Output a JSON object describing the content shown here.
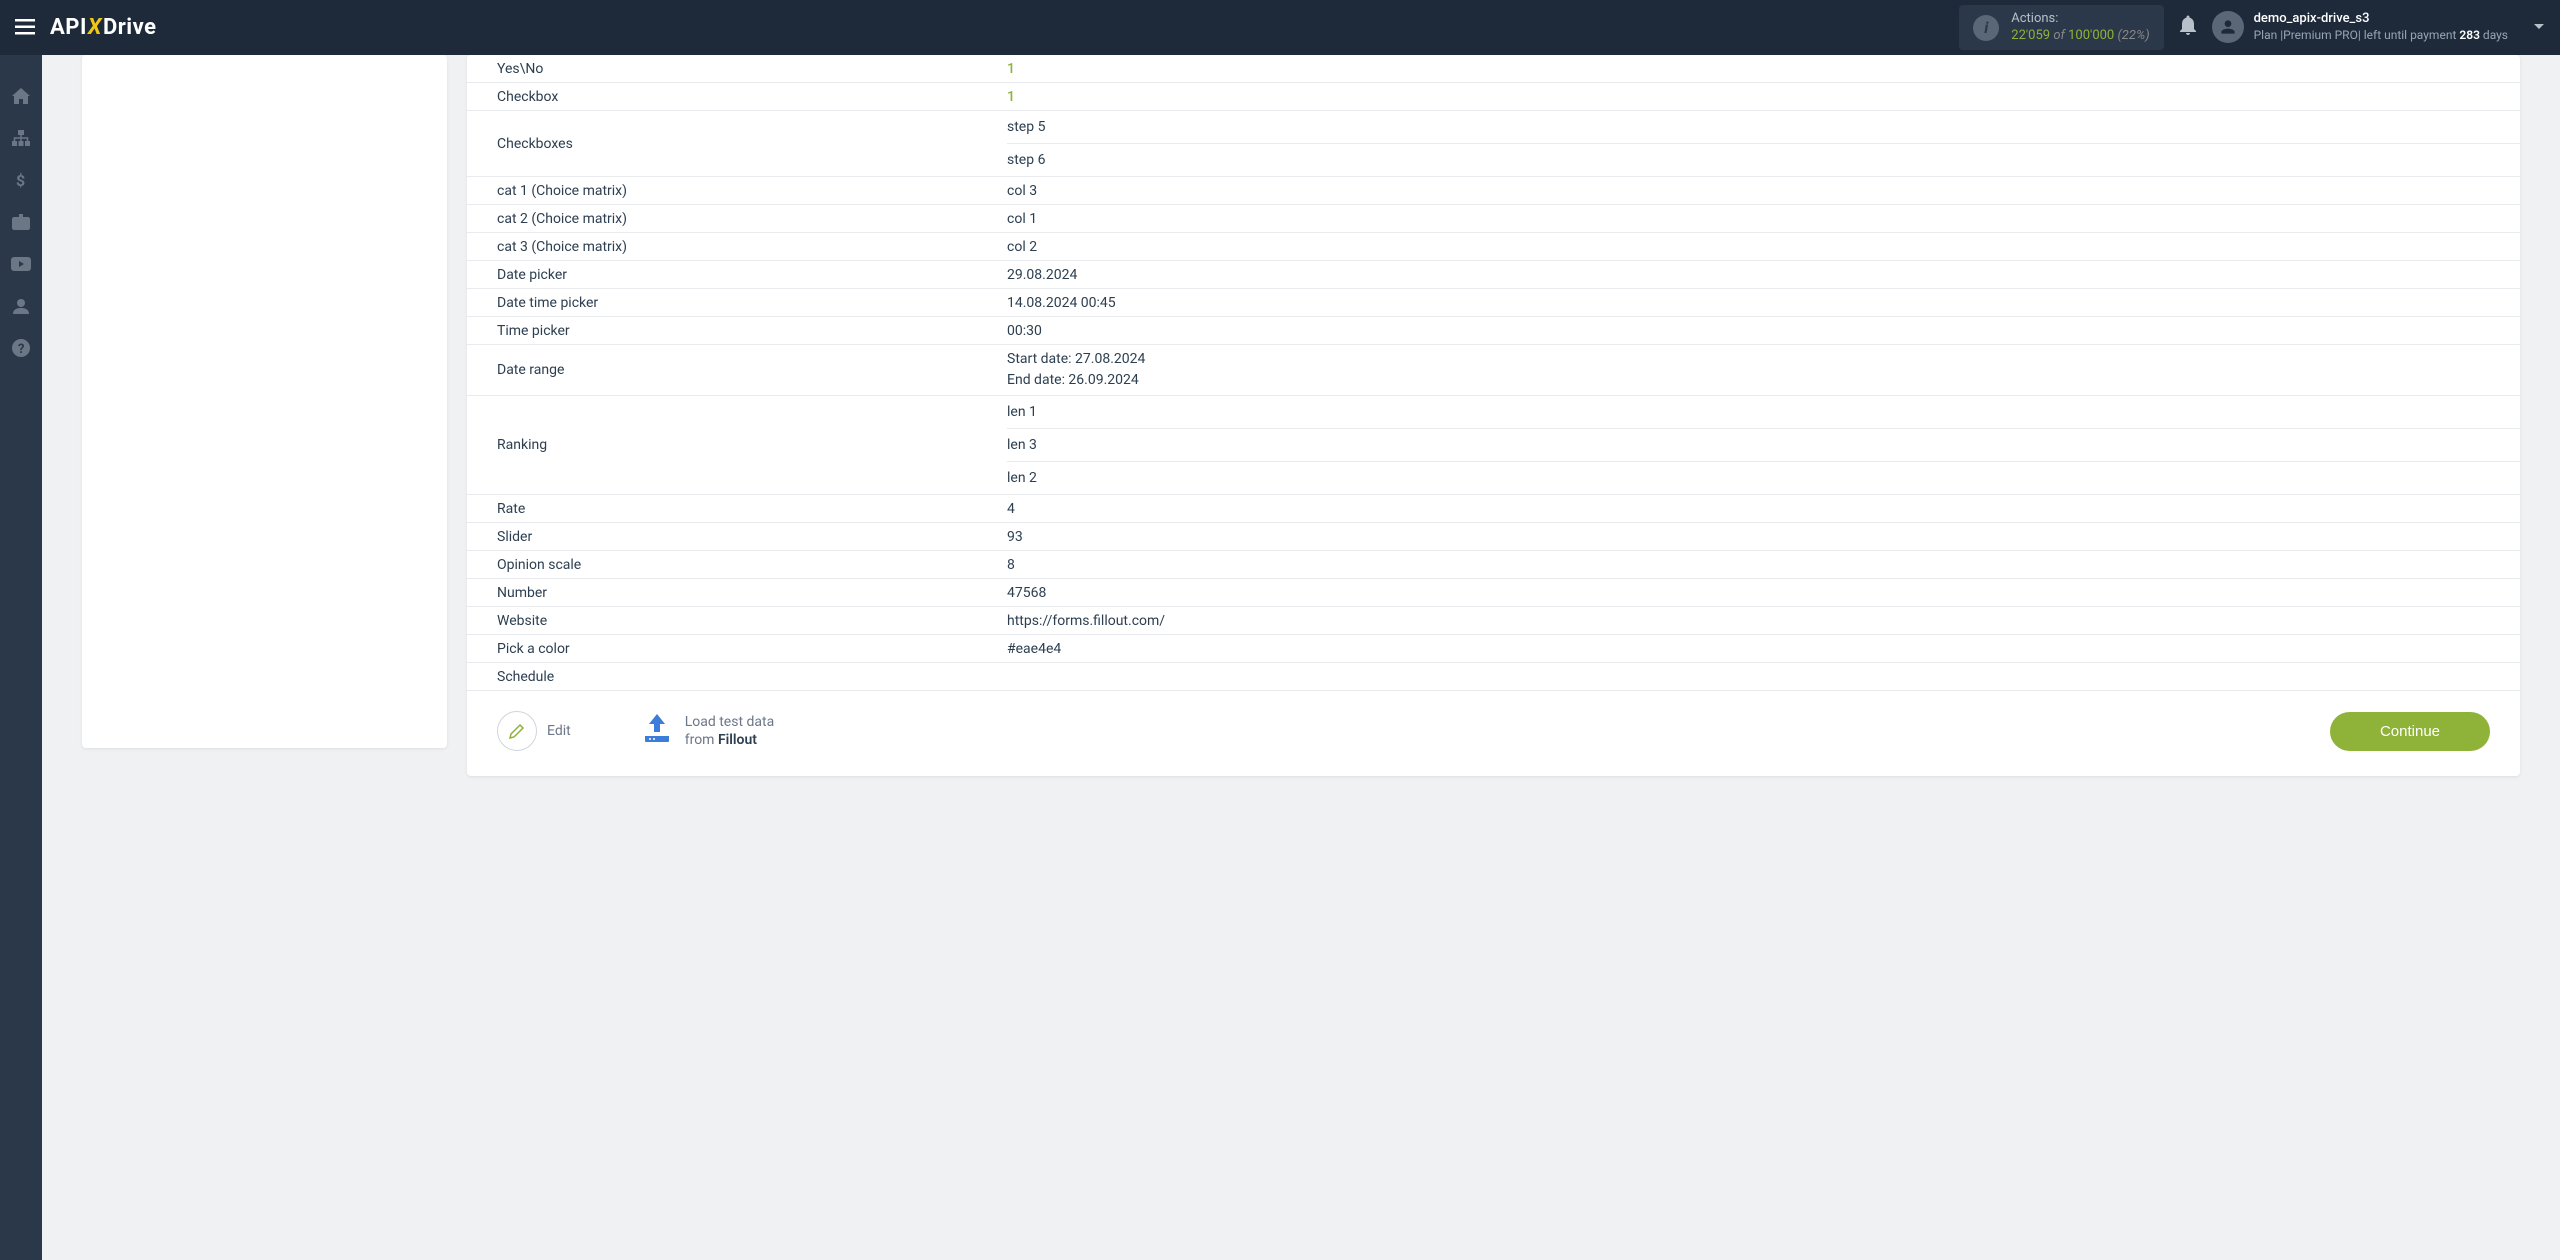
{
  "header": {
    "logo": {
      "api": "API",
      "x": "X",
      "drive": "Drive"
    },
    "actions": {
      "label": "Actions:",
      "current": "22'059",
      "of": "of",
      "total": "100'000",
      "percent": "(22%)"
    },
    "user": {
      "name": "demo_apix-drive_s3",
      "plan_prefix": "Plan |",
      "plan_name": "Premium PRO",
      "plan_suffix": "| left until payment",
      "days": "283",
      "days_label": "days"
    }
  },
  "table": {
    "rows": [
      {
        "label": "Yes\\No",
        "value": "1",
        "green": true
      },
      {
        "label": "Checkbox",
        "value": "1",
        "green": true
      }
    ],
    "checkboxes": {
      "label": "Checkboxes",
      "values": [
        "step 5",
        "step 6"
      ]
    },
    "rows2": [
      {
        "label": "cat 1 (Choice matrix)",
        "value": "col 3"
      },
      {
        "label": "cat 2 (Choice matrix)",
        "value": "col 1"
      },
      {
        "label": "cat 3 (Choice matrix)",
        "value": "col 2"
      },
      {
        "label": "Date picker",
        "value": "29.08.2024"
      },
      {
        "label": "Date time picker",
        "value": "14.08.2024 00:45"
      },
      {
        "label": "Time picker",
        "value": "00:30"
      }
    ],
    "daterange": {
      "label": "Date range",
      "line1": "Start date: 27.08.2024",
      "line2": "End date: 26.09.2024"
    },
    "ranking": {
      "label": "Ranking",
      "values": [
        "len 1",
        "len 3",
        "len 2"
      ]
    },
    "rows3": [
      {
        "label": "Rate",
        "value": "4"
      },
      {
        "label": "Slider",
        "value": "93"
      },
      {
        "label": "Opinion scale",
        "value": "8"
      },
      {
        "label": "Number",
        "value": "47568"
      },
      {
        "label": "Website",
        "value": "https://forms.fillout.com/"
      },
      {
        "label": "Pick a color",
        "value": "#eae4e4"
      },
      {
        "label": "Schedule",
        "value": ""
      }
    ]
  },
  "actions_bar": {
    "edit": "Edit",
    "load_line1": "Load test data",
    "load_from": "from",
    "load_source": "Fillout",
    "continue": "Continue"
  }
}
